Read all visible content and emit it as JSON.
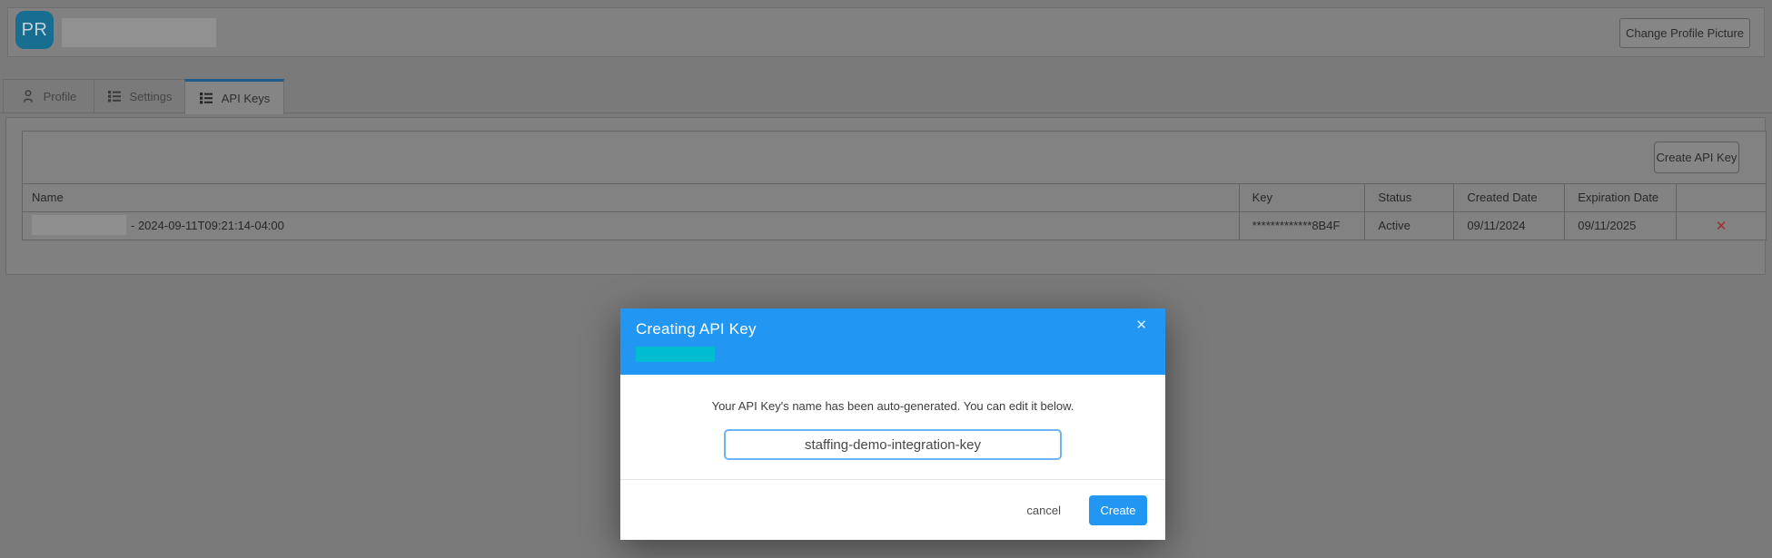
{
  "profile_header": {
    "avatar_initials": "PR",
    "change_picture_button": "Change Profile Picture"
  },
  "tabs": [
    {
      "label": "Profile",
      "icon": "person-icon",
      "active": false
    },
    {
      "label": "Settings",
      "icon": "list-icon",
      "active": false
    },
    {
      "label": "API Keys",
      "icon": "list-icon",
      "active": true
    }
  ],
  "api_keys_panel": {
    "create_button": "Create API Key",
    "table": {
      "columns": {
        "name": "Name",
        "key": "Key",
        "status": "Status",
        "created": "Created Date",
        "expiration": "Expiration Date"
      },
      "row": {
        "name_visible_text": "- 2024-09-11T09:21:14-04:00",
        "key_masked": "*************8B4F",
        "status": "Active",
        "created_date": "09/11/2024",
        "expiration_date": "09/11/2025",
        "delete_icon": "✕"
      }
    }
  },
  "modal": {
    "title": "Creating API Key",
    "close_icon": "✕",
    "message": "Your API Key's name has been auto-generated. You can edit it below.",
    "key_name_input": "staffing-demo-integration-key",
    "cancel_button": "cancel",
    "create_button": "Create"
  },
  "colors": {
    "modal_header_blue": "#2196f3",
    "primary_button_blue": "#2196f3",
    "accent_redaction_teal": "#00bcd0",
    "active_tab_blue": "#2196f3",
    "delete_red": "#c62828"
  }
}
